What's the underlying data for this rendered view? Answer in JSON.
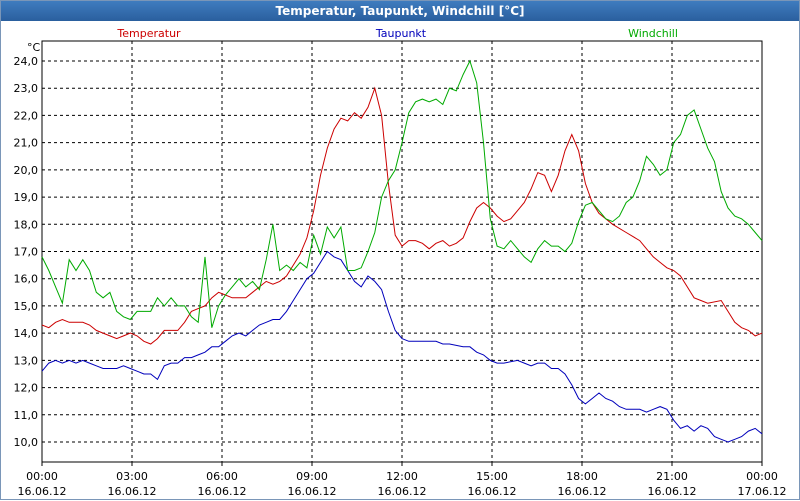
{
  "window": {
    "title": "Temperatur, Taupunkt, Windchill [°C]"
  },
  "chart_data": {
    "type": "line",
    "title": "Temperatur, Taupunkt, Windchill [°C]",
    "yunit": "°C",
    "ylim": [
      9.5,
      24.5
    ],
    "xlim": [
      0,
      24
    ],
    "grid": true,
    "legend_placement": "top",
    "y_ticks": [
      "24,0",
      "23,0",
      "22,0",
      "21,0",
      "20,0",
      "19,0",
      "18,0",
      "17,0",
      "16,0",
      "15,0",
      "14,0",
      "13,0",
      "12,0",
      "11,0",
      "10,0"
    ],
    "x_ticks": [
      {
        "time": "00:00",
        "date": "16.06.12"
      },
      {
        "time": "03:00",
        "date": "16.06.12"
      },
      {
        "time": "06:00",
        "date": "16.06.12"
      },
      {
        "time": "09:00",
        "date": "16.06.12"
      },
      {
        "time": "12:00",
        "date": "16.06.12"
      },
      {
        "time": "15:00",
        "date": "16.06.12"
      },
      {
        "time": "18:00",
        "date": "16.06.12"
      },
      {
        "time": "21:00",
        "date": "16.06.12"
      },
      {
        "time": "00:00",
        "date": "17.06.12"
      }
    ],
    "series": [
      {
        "name": "Temperatur",
        "color": "#cc0000",
        "points": [
          [
            0,
            14.3
          ],
          [
            0.25,
            14.2
          ],
          [
            0.5,
            14.4
          ],
          [
            0.75,
            14.5
          ],
          [
            1,
            14.4
          ],
          [
            1.5,
            14.4
          ],
          [
            1.75,
            14.3
          ],
          [
            2,
            14.1
          ],
          [
            2.5,
            13.9
          ],
          [
            2.75,
            13.8
          ],
          [
            3,
            13.9
          ],
          [
            3.25,
            14.0
          ],
          [
            3.5,
            13.9
          ],
          [
            3.75,
            13.7
          ],
          [
            4,
            13.6
          ],
          [
            4.25,
            13.8
          ],
          [
            4.5,
            14.1
          ],
          [
            5,
            14.1
          ],
          [
            5.25,
            14.4
          ],
          [
            5.5,
            14.8
          ],
          [
            5.75,
            14.9
          ],
          [
            6,
            15.0
          ],
          [
            6.25,
            15.3
          ],
          [
            6.5,
            15.5
          ],
          [
            6.75,
            15.4
          ],
          [
            7,
            15.3
          ],
          [
            7.25,
            15.3
          ],
          [
            7.5,
            15.3
          ],
          [
            7.75,
            15.5
          ],
          [
            8,
            15.7
          ],
          [
            8.25,
            15.9
          ],
          [
            8.5,
            15.8
          ],
          [
            8.75,
            15.9
          ],
          [
            9,
            16.1
          ],
          [
            9.25,
            16.5
          ],
          [
            9.5,
            16.9
          ],
          [
            9.75,
            17.5
          ],
          [
            10,
            18.5
          ],
          [
            10.25,
            19.8
          ],
          [
            10.5,
            20.8
          ],
          [
            10.75,
            21.5
          ],
          [
            11,
            21.9
          ],
          [
            11.25,
            21.8
          ],
          [
            11.5,
            22.1
          ],
          [
            11.75,
            21.9
          ],
          [
            12,
            22.3
          ],
          [
            12.25,
            23.0
          ],
          [
            12.5,
            22.0
          ],
          [
            12.75,
            19.5
          ],
          [
            13,
            17.6
          ],
          [
            13.25,
            17.2
          ],
          [
            13.5,
            17.4
          ],
          [
            13.75,
            17.4
          ],
          [
            14,
            17.3
          ],
          [
            14.25,
            17.1
          ],
          [
            14.5,
            17.3
          ],
          [
            14.75,
            17.4
          ],
          [
            15,
            17.2
          ],
          [
            15.25,
            17.3
          ],
          [
            15.5,
            17.5
          ],
          [
            15.75,
            18.1
          ],
          [
            16,
            18.6
          ],
          [
            16.25,
            18.8
          ],
          [
            16.5,
            18.6
          ],
          [
            16.75,
            18.3
          ],
          [
            17,
            18.1
          ],
          [
            17.25,
            18.2
          ],
          [
            17.5,
            18.5
          ],
          [
            17.75,
            18.8
          ],
          [
            18,
            19.3
          ],
          [
            18.25,
            19.9
          ],
          [
            18.5,
            19.8
          ],
          [
            18.75,
            19.2
          ],
          [
            19,
            19.8
          ],
          [
            19.25,
            20.7
          ],
          [
            19.5,
            21.3
          ],
          [
            19.75,
            20.7
          ],
          [
            20,
            19.5
          ],
          [
            20.25,
            18.8
          ],
          [
            20.5,
            18.4
          ],
          [
            20.75,
            18.2
          ],
          [
            21,
            18.0
          ],
          [
            21.5,
            17.7
          ],
          [
            22,
            17.4
          ],
          [
            22.25,
            17.1
          ],
          [
            22.5,
            16.8
          ],
          [
            22.75,
            16.6
          ],
          [
            23,
            16.4
          ],
          [
            23.25,
            16.3
          ],
          [
            23.5,
            16.1
          ],
          [
            23.75,
            15.7
          ],
          [
            24,
            15.3
          ],
          [
            24.25,
            15.2
          ],
          [
            24.5,
            15.1
          ],
          [
            25,
            15.2
          ],
          [
            25.25,
            14.8
          ],
          [
            25.5,
            14.4
          ],
          [
            25.75,
            14.2
          ],
          [
            26,
            14.1
          ],
          [
            26.25,
            13.9
          ],
          [
            26.5,
            14.0
          ]
        ]
      },
      {
        "name": "Taupunkt",
        "color": "#0000bb",
        "points": [
          [
            0,
            12.6
          ],
          [
            0.25,
            12.9
          ],
          [
            0.5,
            13.0
          ],
          [
            0.75,
            12.9
          ],
          [
            1,
            13.0
          ],
          [
            1.25,
            12.9
          ],
          [
            1.5,
            13.0
          ],
          [
            1.75,
            12.9
          ],
          [
            2,
            12.8
          ],
          [
            2.25,
            12.7
          ],
          [
            2.5,
            12.7
          ],
          [
            2.75,
            12.7
          ],
          [
            3,
            12.8
          ],
          [
            3.25,
            12.7
          ],
          [
            3.5,
            12.6
          ],
          [
            3.75,
            12.5
          ],
          [
            4,
            12.5
          ],
          [
            4.25,
            12.3
          ],
          [
            4.5,
            12.8
          ],
          [
            4.75,
            12.9
          ],
          [
            5,
            12.9
          ],
          [
            5.25,
            13.1
          ],
          [
            5.5,
            13.1
          ],
          [
            5.75,
            13.2
          ],
          [
            6,
            13.3
          ],
          [
            6.25,
            13.5
          ],
          [
            6.5,
            13.5
          ],
          [
            6.75,
            13.7
          ],
          [
            7,
            13.9
          ],
          [
            7.25,
            14.0
          ],
          [
            7.5,
            13.9
          ],
          [
            7.75,
            14.1
          ],
          [
            8,
            14.3
          ],
          [
            8.25,
            14.4
          ],
          [
            8.5,
            14.5
          ],
          [
            8.75,
            14.5
          ],
          [
            9,
            14.8
          ],
          [
            9.25,
            15.2
          ],
          [
            9.5,
            15.6
          ],
          [
            9.75,
            16.0
          ],
          [
            10,
            16.2
          ],
          [
            10.25,
            16.6
          ],
          [
            10.5,
            17.0
          ],
          [
            10.75,
            16.8
          ],
          [
            11,
            16.7
          ],
          [
            11.25,
            16.3
          ],
          [
            11.5,
            15.9
          ],
          [
            11.75,
            15.7
          ],
          [
            12,
            16.1
          ],
          [
            12.25,
            15.9
          ],
          [
            12.5,
            15.6
          ],
          [
            12.75,
            14.8
          ],
          [
            13,
            14.1
          ],
          [
            13.25,
            13.8
          ],
          [
            13.5,
            13.7
          ],
          [
            14,
            13.7
          ],
          [
            14.5,
            13.7
          ],
          [
            14.75,
            13.6
          ],
          [
            15,
            13.6
          ],
          [
            15.5,
            13.5
          ],
          [
            15.75,
            13.5
          ],
          [
            16,
            13.3
          ],
          [
            16.25,
            13.2
          ],
          [
            16.5,
            13.0
          ],
          [
            16.75,
            12.9
          ],
          [
            17,
            12.9
          ],
          [
            17.5,
            13.0
          ],
          [
            17.75,
            12.9
          ],
          [
            18,
            12.8
          ],
          [
            18.25,
            12.9
          ],
          [
            18.5,
            12.9
          ],
          [
            18.75,
            12.7
          ],
          [
            19,
            12.7
          ],
          [
            19.25,
            12.5
          ],
          [
            19.5,
            12.1
          ],
          [
            19.75,
            11.6
          ],
          [
            20,
            11.4
          ],
          [
            20.25,
            11.6
          ],
          [
            20.5,
            11.8
          ],
          [
            20.75,
            11.6
          ],
          [
            21,
            11.5
          ],
          [
            21.25,
            11.3
          ],
          [
            21.5,
            11.2
          ],
          [
            22,
            11.2
          ],
          [
            22.25,
            11.1
          ],
          [
            22.5,
            11.2
          ],
          [
            22.75,
            11.3
          ],
          [
            23,
            11.2
          ],
          [
            23.25,
            10.8
          ],
          [
            23.5,
            10.5
          ],
          [
            23.75,
            10.6
          ],
          [
            24,
            10.4
          ],
          [
            24.25,
            10.6
          ],
          [
            24.5,
            10.5
          ],
          [
            24.75,
            10.2
          ],
          [
            25,
            10.1
          ],
          [
            25.25,
            10.0
          ],
          [
            25.5,
            10.1
          ],
          [
            25.75,
            10.2
          ],
          [
            26,
            10.4
          ],
          [
            26.25,
            10.5
          ],
          [
            26.5,
            10.3
          ]
        ]
      },
      {
        "name": "Windchill",
        "color": "#00aa00",
        "points": [
          [
            0,
            16.8
          ],
          [
            0.25,
            16.3
          ],
          [
            0.5,
            15.7
          ],
          [
            0.75,
            15.1
          ],
          [
            1,
            16.7
          ],
          [
            1.25,
            16.3
          ],
          [
            1.5,
            16.7
          ],
          [
            1.75,
            16.3
          ],
          [
            2,
            15.5
          ],
          [
            2.25,
            15.3
          ],
          [
            2.5,
            15.5
          ],
          [
            2.75,
            14.8
          ],
          [
            3,
            14.6
          ],
          [
            3.25,
            14.5
          ],
          [
            3.5,
            14.8
          ],
          [
            3.75,
            14.8
          ],
          [
            4,
            14.8
          ],
          [
            4.25,
            15.3
          ],
          [
            4.5,
            15.0
          ],
          [
            4.75,
            15.3
          ],
          [
            5,
            15.0
          ],
          [
            5.25,
            15.0
          ],
          [
            5.5,
            14.6
          ],
          [
            5.75,
            14.4
          ],
          [
            6,
            16.8
          ],
          [
            6.25,
            14.2
          ],
          [
            6.5,
            15.0
          ],
          [
            6.75,
            15.4
          ],
          [
            7,
            15.7
          ],
          [
            7.25,
            16.0
          ],
          [
            7.5,
            15.7
          ],
          [
            7.75,
            15.9
          ],
          [
            8,
            15.6
          ],
          [
            8.25,
            16.7
          ],
          [
            8.5,
            18.0
          ],
          [
            8.75,
            16.3
          ],
          [
            9,
            16.5
          ],
          [
            9.25,
            16.3
          ],
          [
            9.5,
            16.6
          ],
          [
            9.75,
            16.4
          ],
          [
            10,
            17.6
          ],
          [
            10.25,
            16.9
          ],
          [
            10.5,
            17.9
          ],
          [
            10.75,
            17.5
          ],
          [
            11,
            17.9
          ],
          [
            11.25,
            16.3
          ],
          [
            11.5,
            16.3
          ],
          [
            11.75,
            16.4
          ],
          [
            12,
            17.0
          ],
          [
            12.25,
            17.7
          ],
          [
            12.5,
            19.0
          ],
          [
            12.75,
            19.6
          ],
          [
            13,
            20.0
          ],
          [
            13.25,
            21.0
          ],
          [
            13.5,
            22.1
          ],
          [
            13.75,
            22.5
          ],
          [
            14,
            22.6
          ],
          [
            14.25,
            22.5
          ],
          [
            14.5,
            22.6
          ],
          [
            14.75,
            22.4
          ],
          [
            15,
            23.0
          ],
          [
            15.25,
            22.9
          ],
          [
            15.5,
            23.5
          ],
          [
            15.75,
            24.0
          ],
          [
            16,
            23.2
          ],
          [
            16.25,
            21.0
          ],
          [
            16.5,
            18.2
          ],
          [
            16.75,
            17.2
          ],
          [
            17,
            17.1
          ],
          [
            17.25,
            17.4
          ],
          [
            17.5,
            17.1
          ],
          [
            17.75,
            16.8
          ],
          [
            18,
            16.6
          ],
          [
            18.25,
            17.1
          ],
          [
            18.5,
            17.4
          ],
          [
            18.75,
            17.2
          ],
          [
            19,
            17.2
          ],
          [
            19.25,
            17.0
          ],
          [
            19.5,
            17.3
          ],
          [
            19.75,
            18.1
          ],
          [
            20,
            18.7
          ],
          [
            20.25,
            18.8
          ],
          [
            20.5,
            18.5
          ],
          [
            20.75,
            18.2
          ],
          [
            21,
            18.1
          ],
          [
            21.25,
            18.3
          ],
          [
            21.5,
            18.8
          ],
          [
            21.75,
            19.0
          ],
          [
            22,
            19.6
          ],
          [
            22.25,
            20.5
          ],
          [
            22.5,
            20.2
          ],
          [
            22.75,
            19.8
          ],
          [
            23,
            20.0
          ],
          [
            23.25,
            21.0
          ],
          [
            23.5,
            21.3
          ],
          [
            23.75,
            22.0
          ],
          [
            24,
            22.2
          ],
          [
            24.25,
            21.5
          ],
          [
            24.5,
            20.8
          ],
          [
            24.75,
            20.3
          ],
          [
            25,
            19.2
          ],
          [
            25.25,
            18.6
          ],
          [
            25.5,
            18.3
          ],
          [
            25.75,
            18.2
          ],
          [
            26,
            18.0
          ],
          [
            26.25,
            17.7
          ],
          [
            26.5,
            17.4
          ]
        ]
      }
    ]
  }
}
